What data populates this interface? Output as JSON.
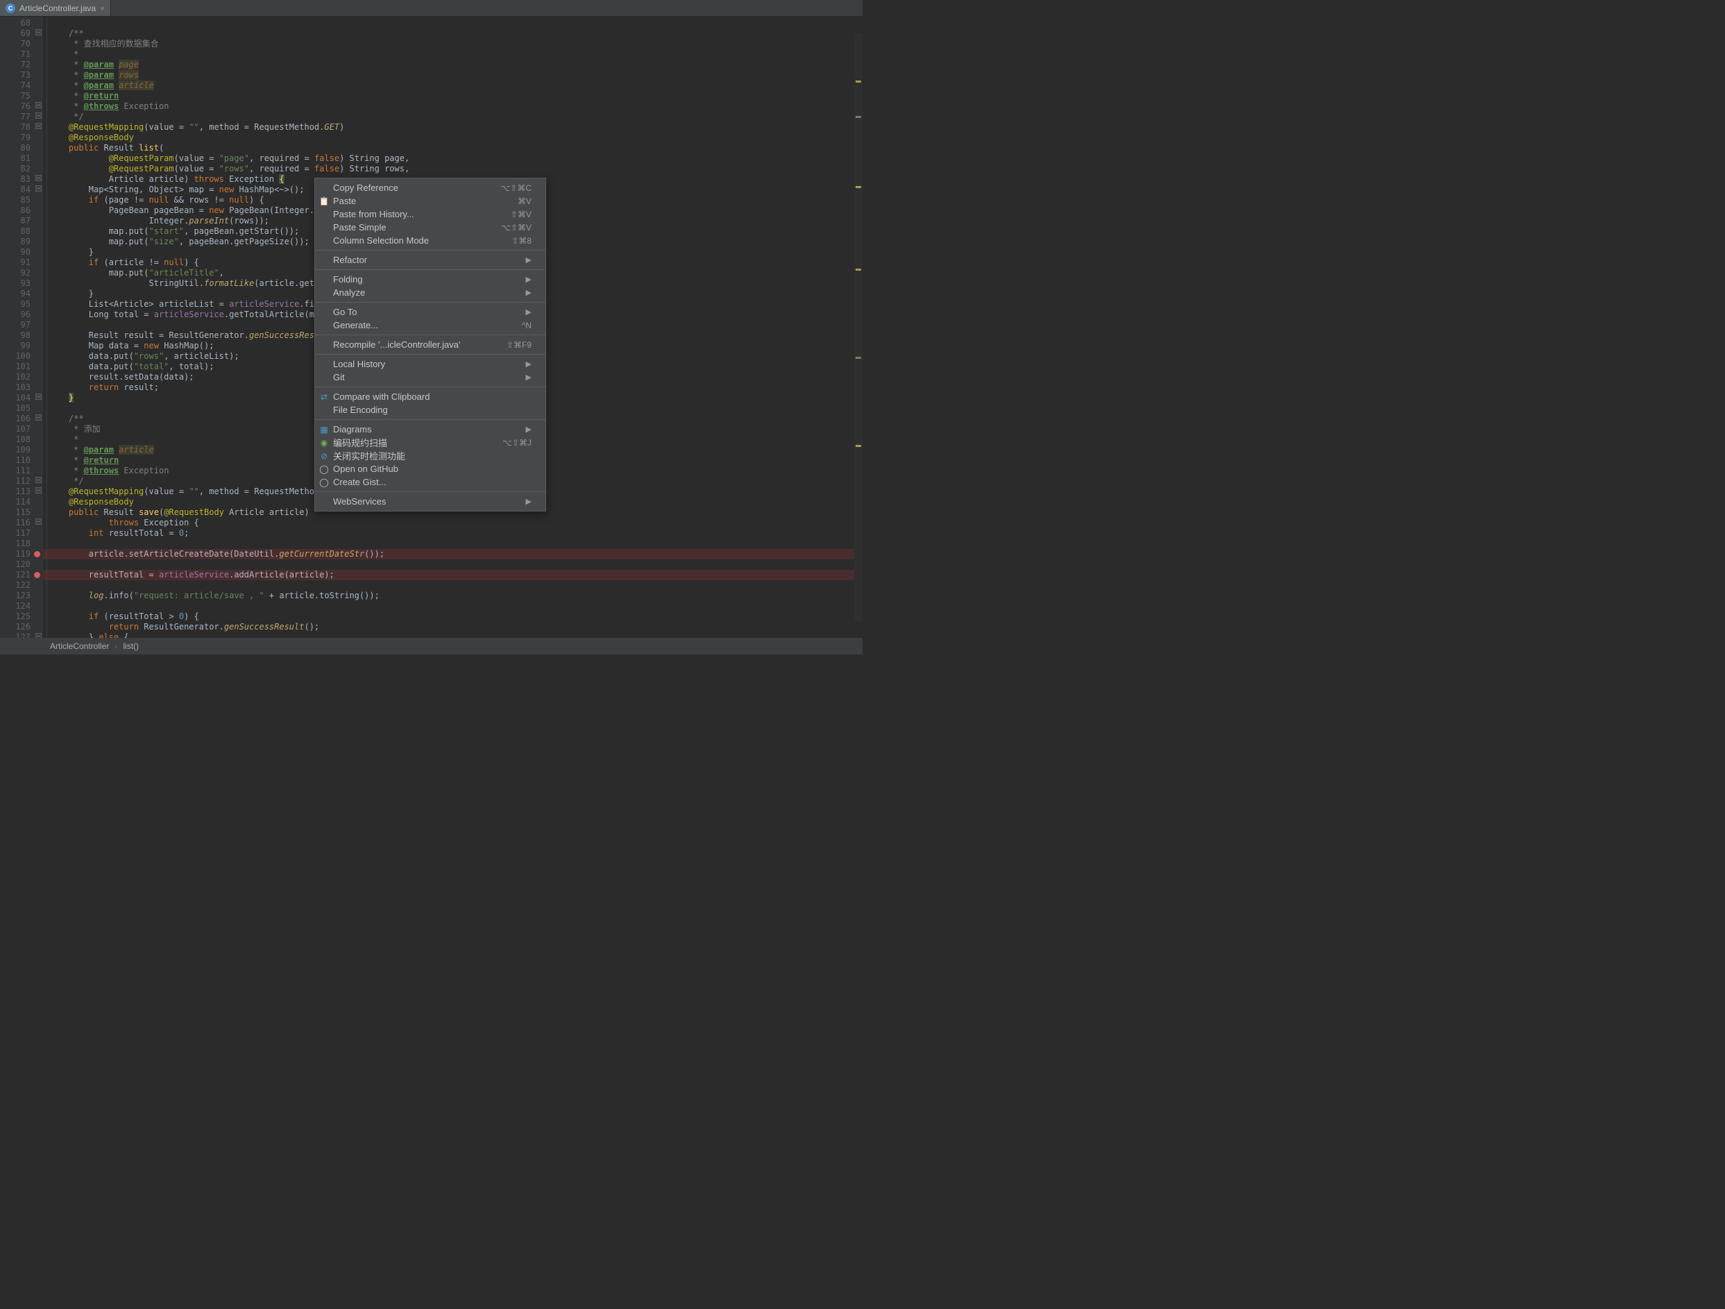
{
  "tab": {
    "filename": "ArticleController.java",
    "icon_letter": "C"
  },
  "breadcrumb": {
    "class": "ArticleController",
    "method": "list()"
  },
  "gutter": {
    "start": 68,
    "end": 127,
    "folds": [
      69,
      76,
      77,
      78,
      83,
      84,
      104,
      106,
      112,
      113,
      116,
      127
    ],
    "breakpoints": [
      119,
      121
    ]
  },
  "code_lines": [
    {
      "n": 68,
      "html": ""
    },
    {
      "n": 69,
      "html": "<span class='c-comment'>/**</span>"
    },
    {
      "n": 70,
      "html": "<span class='c-comment'> * 查找相应的数据集合</span>"
    },
    {
      "n": 71,
      "html": "<span class='c-comment'> *</span>"
    },
    {
      "n": 72,
      "html": "<span class='c-comment'> * </span><span class='c-tag'>@param</span> <span class='c-tagparam'>page</span>"
    },
    {
      "n": 73,
      "html": "<span class='c-comment'> * </span><span class='c-tag'>@param</span> <span class='c-tagparam'>rows</span>"
    },
    {
      "n": 74,
      "html": "<span class='c-comment'> * </span><span class='c-tag'>@param</span> <span class='c-tagparam'>article</span>"
    },
    {
      "n": 75,
      "html": "<span class='c-comment'> * </span><span class='c-tag'>@return</span>"
    },
    {
      "n": 76,
      "html": "<span class='c-comment'> * </span><span class='c-tag'>@throws</span><span class='c-comment'> Exception</span>"
    },
    {
      "n": 77,
      "html": "<span class='c-comment'> */</span>"
    },
    {
      "n": 78,
      "html": "<span class='c-ann'>@RequestMapping</span>(value = <span class='c-str'>\"\"</span>, method = RequestMethod.<span class='c-static'>GET</span>)"
    },
    {
      "n": 79,
      "html": "<span class='c-ann'>@ResponseBody</span>"
    },
    {
      "n": 80,
      "html": "<span class='c-kw'>public</span> Result <span class='c-method'>list</span>("
    },
    {
      "n": 81,
      "html": "        <span class='c-ann'>@RequestParam</span>(value = <span class='c-str'>\"page\"</span>, required = <span class='c-kw'>false</span>) String page,"
    },
    {
      "n": 82,
      "html": "        <span class='c-ann'>@RequestParam</span>(value = <span class='c-str'>\"rows\"</span>, required = <span class='c-kw'>false</span>) String rows,"
    },
    {
      "n": 83,
      "html": "        Article article) <span class='c-kw'>throws</span> Exception <span class='c-brace-hl'>{</span>"
    },
    {
      "n": 84,
      "html": "    Map&lt;String, Object&gt; map = <span class='c-kw'>new</span> HashMap&lt;~&gt;();"
    },
    {
      "n": 85,
      "html": "    <span class='c-kw'>if</span> (page != <span class='c-kw'>null</span> &amp;&amp; rows != <span class='c-kw'>null</span>) {"
    },
    {
      "n": 86,
      "html": "        PageBean pageBean = <span class='c-kw'>new</span> PageBean(Integer.<span class='c-static'>p</span>"
    },
    {
      "n": 87,
      "html": "                Integer.<span class='c-static'>parseInt</span>(rows));"
    },
    {
      "n": 88,
      "html": "        map.put(<span class='c-str'>\"start\"</span>, pageBean.getStart());"
    },
    {
      "n": 89,
      "html": "        map.put(<span class='c-str'>\"size\"</span>, pageBean.getPageSize());"
    },
    {
      "n": 90,
      "html": "    }"
    },
    {
      "n": 91,
      "html": "    <span class='c-kw'>if</span> (article != <span class='c-kw'>null</span>) {"
    },
    {
      "n": 92,
      "html": "        map.put(<span class='c-str'>\"articleTitle\"</span>,"
    },
    {
      "n": 93,
      "html": "                StringUtil.<span class='c-static'>formatLike</span>(article.getA"
    },
    {
      "n": 94,
      "html": "    }"
    },
    {
      "n": 95,
      "html": "    List&lt;Article&gt; articleList = <span class='c-field'>articleService</span>.fin"
    },
    {
      "n": 96,
      "html": "    Long total = <span class='c-field'>articleService</span>.getTotalArticle(ma"
    },
    {
      "n": 97,
      "html": ""
    },
    {
      "n": 98,
      "html": "    Result result = ResultGenerator.<span class='c-static'>genSuccessResu</span>"
    },
    {
      "n": 99,
      "html": "    Map data = <span class='c-kw'>new</span> HashMap();"
    },
    {
      "n": 100,
      "html": "    data.put(<span class='c-str'>\"rows\"</span>, articleList);"
    },
    {
      "n": 101,
      "html": "    data.put(<span class='c-str'>\"total\"</span>, total);"
    },
    {
      "n": 102,
      "html": "    result.setData(data);"
    },
    {
      "n": 103,
      "html": "    <span class='c-kw'>return</span> result;"
    },
    {
      "n": 104,
      "html": "<span class='c-brace-hl'>}</span>"
    },
    {
      "n": 105,
      "html": ""
    },
    {
      "n": 106,
      "html": "<span class='c-comment'>/**</span>"
    },
    {
      "n": 107,
      "html": "<span class='c-comment'> * 添加</span>"
    },
    {
      "n": 108,
      "html": "<span class='c-comment'> *</span>"
    },
    {
      "n": 109,
      "html": "<span class='c-comment'> * </span><span class='c-tag'>@param</span> <span class='c-tagparam'>article</span>"
    },
    {
      "n": 110,
      "html": "<span class='c-comment'> * </span><span class='c-tag'>@return</span>"
    },
    {
      "n": 111,
      "html": "<span class='c-comment'> * </span><span class='c-tag'>@throws</span><span class='c-comment'> Exception</span>"
    },
    {
      "n": 112,
      "html": "<span class='c-comment'> */</span>"
    },
    {
      "n": 113,
      "html": "<span class='c-ann'>@RequestMapping</span>(value = <span class='c-str'>\"\"</span>, method = RequestMethod"
    },
    {
      "n": 114,
      "html": "<span class='c-ann'>@ResponseBody</span>"
    },
    {
      "n": 115,
      "html": "<span class='c-kw'>public</span> Result <span class='c-method'>save</span>(<span class='c-ann'>@RequestBody</span> Article article)"
    },
    {
      "n": 116,
      "html": "        <span class='c-kw'>throws</span> Exception {"
    },
    {
      "n": 117,
      "html": "    <span class='c-kw'>int</span> resultTotal = <span class='c-num'>0</span>;"
    },
    {
      "n": 118,
      "html": ""
    },
    {
      "n": 119,
      "html": "    article.setArticleCreateDate(DateUtil.<span class='c-static'>getCurrentDateStr</span>());",
      "bp": true
    },
    {
      "n": 120,
      "html": ""
    },
    {
      "n": 121,
      "html": "    resultTotal = <span class='c-field'>articleService</span>.addArticle(article);",
      "bp": true
    },
    {
      "n": 122,
      "html": ""
    },
    {
      "n": 123,
      "html": "    <span class='c-static'>log</span>.info(<span class='c-str'>\"request: article/save , \"</span> + article.toString());"
    },
    {
      "n": 124,
      "html": ""
    },
    {
      "n": 125,
      "html": "    <span class='c-kw'>if</span> (resultTotal &gt; <span class='c-num'>0</span>) {"
    },
    {
      "n": 126,
      "html": "        <span class='c-kw'>return</span> ResultGenerator.<span class='c-static'>genSuccessResult</span>();"
    },
    {
      "n": 127,
      "html": "    } <span class='c-kw'>else</span> {"
    }
  ],
  "indent": "    ",
  "context_menu": {
    "groups": [
      [
        {
          "label": "Copy Reference",
          "shortcut": "⌥⇧⌘C"
        },
        {
          "label": "Paste",
          "shortcut": "⌘V",
          "icon": "📋",
          "icon_name": "paste-icon"
        },
        {
          "label": "Paste from History...",
          "shortcut": "⇧⌘V"
        },
        {
          "label": "Paste Simple",
          "shortcut": "⌥⇧⌘V"
        },
        {
          "label": "Column Selection Mode",
          "shortcut": "⇧⌘8"
        }
      ],
      [
        {
          "label": "Refactor",
          "sub": true
        }
      ],
      [
        {
          "label": "Folding",
          "sub": true
        },
        {
          "label": "Analyze",
          "sub": true
        }
      ],
      [
        {
          "label": "Go To",
          "sub": true
        },
        {
          "label": "Generate...",
          "shortcut": "^N"
        }
      ],
      [
        {
          "label": "Recompile '...icleController.java'",
          "shortcut": "⇧⌘F9"
        }
      ],
      [
        {
          "label": "Local History",
          "sub": true
        },
        {
          "label": "Git",
          "sub": true
        }
      ],
      [
        {
          "label": "Compare with Clipboard",
          "icon": "⇄",
          "icon_name": "compare-icon",
          "icon_color": "#4a9cc7"
        },
        {
          "label": "File Encoding"
        }
      ],
      [
        {
          "label": "Diagrams",
          "sub": true,
          "icon": "▦",
          "icon_name": "diagram-icon",
          "icon_color": "#4a9cc7"
        },
        {
          "label": "编码规约扫描",
          "shortcut": "⌥⇧⌘J",
          "icon": "◉",
          "icon_name": "scan-icon",
          "icon_color": "#6fb24d"
        },
        {
          "label": "关闭实时检测功能",
          "icon": "⊘",
          "icon_name": "disable-icon",
          "icon_color": "#4a9cc7"
        },
        {
          "label": "Open on GitHub",
          "icon": "◯",
          "icon_name": "github-icon"
        },
        {
          "label": "Create Gist...",
          "icon": "◯",
          "icon_name": "gist-icon"
        }
      ],
      [
        {
          "label": "WebServices",
          "sub": true
        }
      ]
    ]
  }
}
